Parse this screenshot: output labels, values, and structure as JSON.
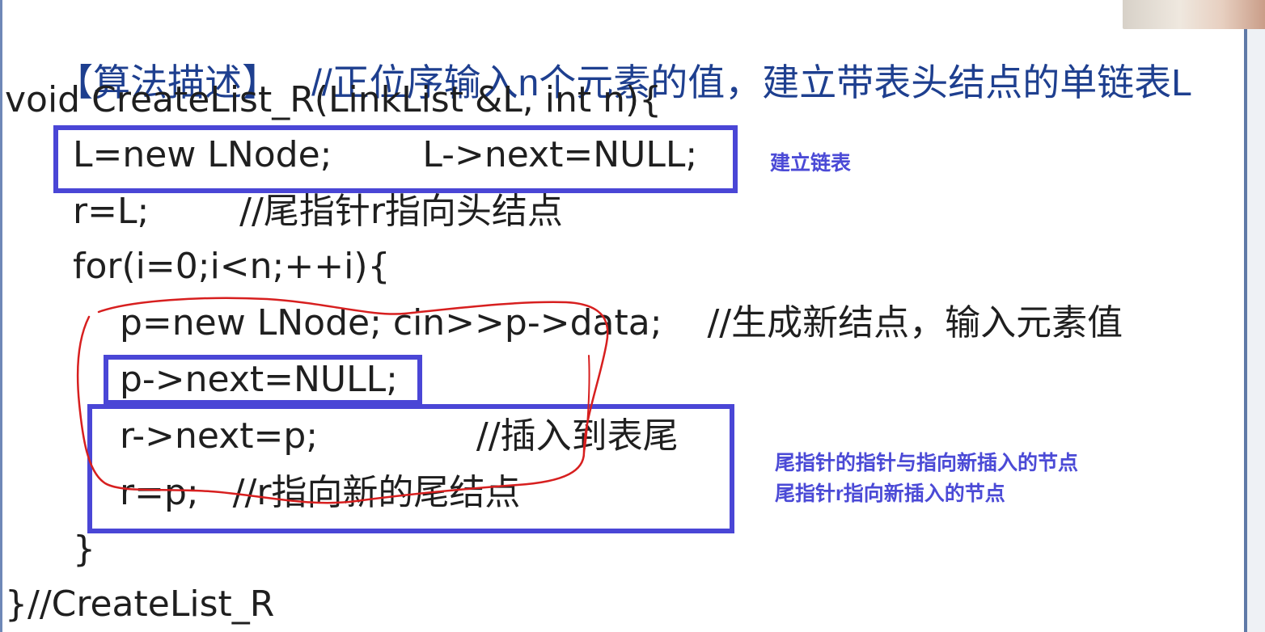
{
  "slide": {
    "title_bracket": "【算法描述】",
    "title_comment": "//正位序输入n个元素的值，建立带表头结点的单链表L",
    "code_lines": [
      "void CreateList_R(LinkList &L, int n){",
      "L=new LNode;        L->next=NULL;",
      "r=L;        //尾指针r指向头结点",
      "for(i=0;i<n;++i){",
      "p=new LNode; cin>>p->data;    //生成新结点，输入元素值",
      "p->next=NULL;",
      "r->next=p;              //插入到表尾",
      "r=p;   //r指向新的尾结点",
      "}",
      "}//CreateList_R"
    ]
  },
  "annotations": {
    "build_list": "建立链表",
    "tail_note_1": "尾指针的指针与指向新插入的节点",
    "tail_note_2": "尾指针r指向新插入的节点"
  },
  "colors": {
    "box_border": "#4a46d6",
    "scribble": "#d71f1f",
    "annotation": "#4b4ad6",
    "comment": "#1e3f8f"
  }
}
